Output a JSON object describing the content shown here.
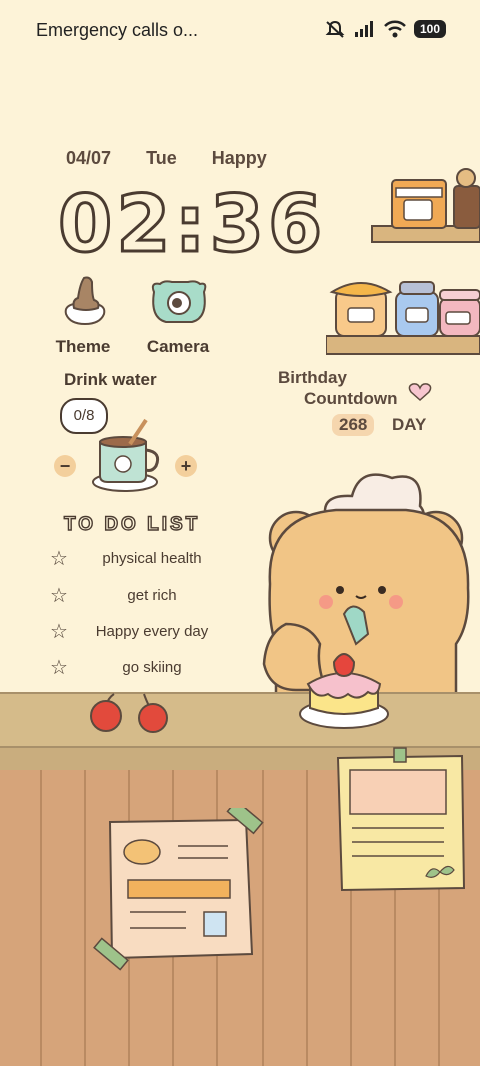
{
  "status_bar": {
    "carrier_text": "Emergency calls o...",
    "battery": "100",
    "icons": [
      "silent-icon",
      "signal-icon",
      "wifi-icon",
      "battery-icon"
    ]
  },
  "date": {
    "day": "04/07",
    "weekday": "Tue",
    "mood": "Happy"
  },
  "clock": {
    "time": "02:36"
  },
  "apps": [
    {
      "label": "Theme",
      "icon": "theme-icon"
    },
    {
      "label": "Camera",
      "icon": "camera-icon"
    }
  ],
  "drink": {
    "label": "Drink water",
    "count": "0/8",
    "minus": "−",
    "plus": "+"
  },
  "birthday": {
    "line1": "Birthday",
    "line2": "Countdown",
    "days": "268",
    "unit": "DAY"
  },
  "todo": {
    "title": "TO DO LIST",
    "items": [
      "physical health",
      "get rich",
      "Happy every day",
      "go skiing"
    ]
  },
  "colors": {
    "background": "#fdf3d8",
    "ink": "#4a3b30",
    "floor": "#d6a47a",
    "counter": "#d5bb8a"
  }
}
